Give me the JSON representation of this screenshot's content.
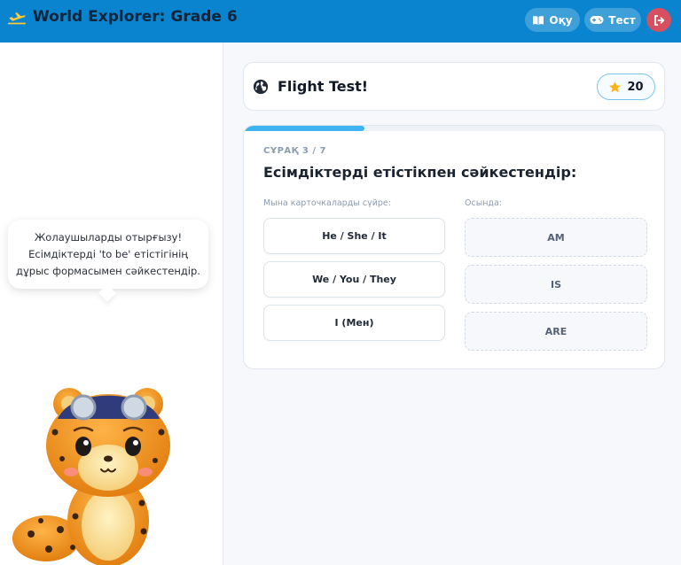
{
  "header": {
    "app_title": "World Explorer: Grade 6",
    "read_label": "Оқу",
    "test_label": "Тест",
    "logo_icon": "airplane-icon",
    "read_icon": "book-icon",
    "test_icon": "gamepad-icon",
    "exit_icon": "logout-icon",
    "bg_color": "#0a84cf"
  },
  "sidebar": {
    "speech_lines": [
      "Жолаушыларды отырғызу!",
      "Есімдіктерді 'to be' етістігінің",
      "дұрыс формасымен сәйкестендір."
    ],
    "mascot": "leopard-pilot-mascot"
  },
  "main": {
    "title": "Flight Test!",
    "score": "20",
    "score_icon": "star-icon",
    "title_icon": "globe-icon",
    "quiz": {
      "counter": "СҰРАҚ 3 / 7",
      "progress": 0.285,
      "question": "Есімдіктерді етістікпен сәйкестендір:",
      "drag_label": "Мына карточкаларды сүйре:",
      "drop_label": "Осында:",
      "cards": [
        "He / She / It",
        "We / You / They",
        "I (Мен)"
      ],
      "targets": [
        "AM",
        "IS",
        "ARE"
      ]
    }
  }
}
